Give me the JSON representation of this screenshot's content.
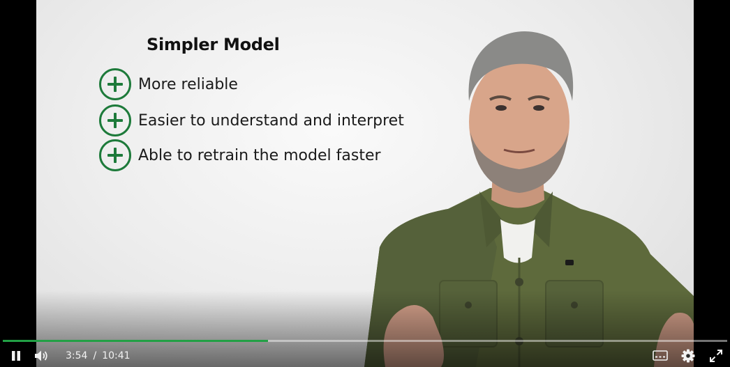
{
  "slide": {
    "title": "Simpler Model",
    "bullets": [
      {
        "icon": "plus-circle-icon",
        "text": "More reliable"
      },
      {
        "icon": "plus-circle-icon",
        "text": "Easier to understand and interpret"
      },
      {
        "icon": "plus-circle-icon",
        "text": "Able to retrain the model faster"
      }
    ]
  },
  "player": {
    "current_time": "3:54",
    "separator": "/",
    "duration": "10:41",
    "progress_fraction": 0.366,
    "accent_color": "#22a045",
    "icons": {
      "play_pause": "pause-icon",
      "volume": "volume-icon",
      "captions": "captions-icon",
      "settings": "gear-icon",
      "fullscreen": "fullscreen-icon"
    }
  }
}
